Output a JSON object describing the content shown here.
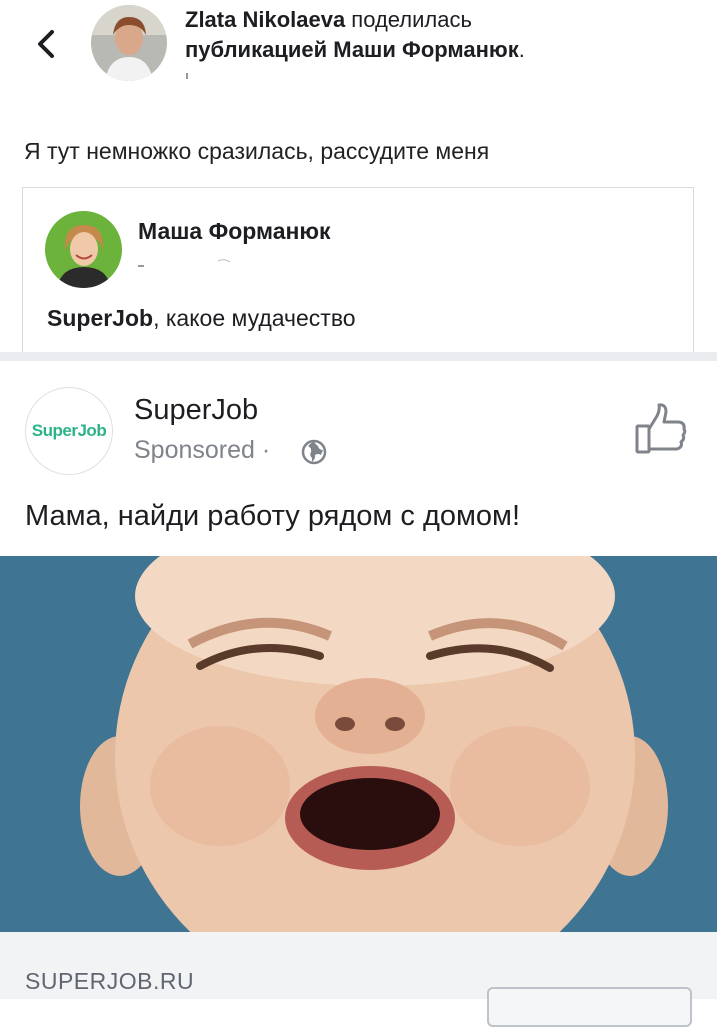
{
  "header": {
    "author": "Zlata Nikolaeva",
    "action": " поделилась ",
    "shared_from": "публикацией Маши Форманюк",
    "period": "."
  },
  "post": {
    "message": "Я тут немножко сразилась, рассудите меня"
  },
  "shared_post": {
    "author": "Маша Форманюк",
    "text_tag": "SuperJob",
    "text_rest": ", какое мудачество"
  },
  "ad": {
    "page_name": "SuperJob",
    "logo_text": "SuperJob",
    "sponsored_label": "Sponsored",
    "separator": " ·",
    "text": "Мама, найди работу рядом с домом!",
    "link_domain": "SUPERJOB.RU",
    "accent_color": "#2db38a",
    "image_background_color": "#3a6f8f"
  },
  "icons": {
    "back": "chevron-left-icon",
    "globe": "globe-icon",
    "like": "thumbs-up-icon"
  }
}
